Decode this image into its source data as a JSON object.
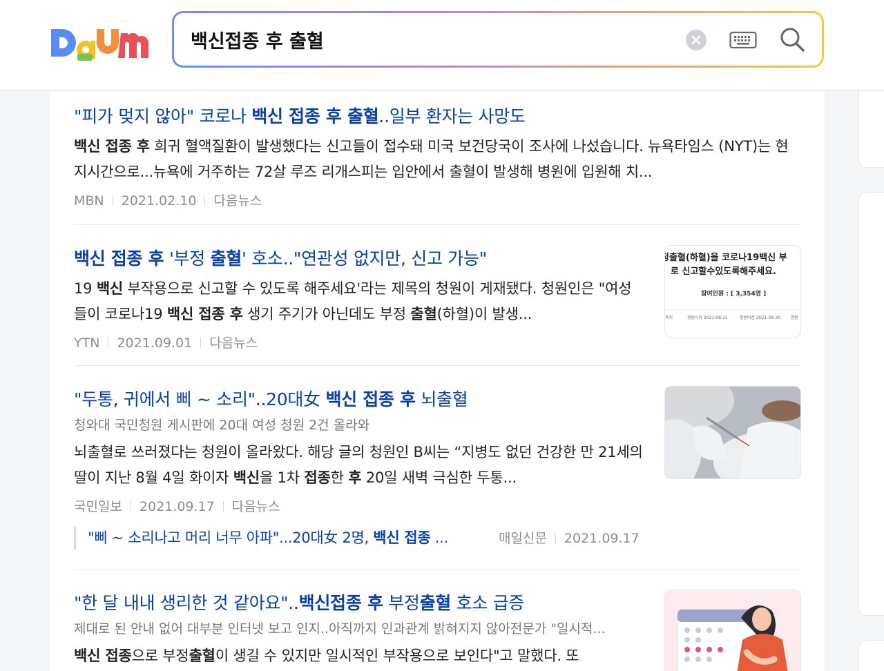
{
  "header": {
    "logo_text": "Daum",
    "search_value": "백신접종 후 출혈",
    "clear_icon": "close-icon",
    "keyboard_icon": "keyboard-icon",
    "search_icon": "search-icon"
  },
  "results": [
    {
      "title_parts": [
        {
          "t": "\"피가 멎지 않아\" 코로나 ",
          "b": false
        },
        {
          "t": "백신 접종 후 출혈",
          "b": true
        },
        {
          "t": "..일부 환자는 사망도",
          "b": false
        }
      ],
      "desc_parts": [
        {
          "t": "백신 접종 후",
          "b": true
        },
        {
          "t": " 희귀 혈액질환이 발생했다는 신고들이 접수돼 미국 보건당국이 조사에 나섰습니다. 뉴욕타임스 (NYT)는 현지시간으로...뉴욕에 거주하는 72살 루즈 리개스피는 입안에서 출혈이 발생해 병원에 입원해 치...",
          "b": false
        }
      ],
      "source": "MBN",
      "date": "2021.02.10",
      "platform": "다음뉴스"
    },
    {
      "title_parts": [
        {
          "t": "백신 접종 후",
          "b": true
        },
        {
          "t": " '부정 ",
          "b": false
        },
        {
          "t": "출혈",
          "b": true
        },
        {
          "t": "' 호소..\"연관성 없지만, 신고 가능\"",
          "b": false
        }
      ],
      "desc_parts": [
        {
          "t": "19 ",
          "b": false
        },
        {
          "t": "백신",
          "b": true
        },
        {
          "t": " 부작용으로 신고할 수 있도록 해주세요'라는 제목의 청원이 게재됐다. 청원인은 \"여성들이 코로나19 ",
          "b": false
        },
        {
          "t": "백신 접종 후",
          "b": true
        },
        {
          "t": " 생기 주기가 아닌데도 부정 ",
          "b": false
        },
        {
          "t": "출혈",
          "b": true
        },
        {
          "t": "(하혈)이 발생...",
          "b": false
        }
      ],
      "source": "YTN",
      "date": "2021.09.01",
      "platform": "다음뉴스",
      "thumb": {
        "line1": "정출혈(하혈)을 코로나19백신 부",
        "line2": "로 신고할수있도록해주세요.",
        "participants": "참여인원 : [ 3,354명 ]",
        "start": "청원시작 2021-08-31",
        "end": "청원마감 2021-09-30",
        "edge_left": "목지",
        "edge_right": "청원"
      }
    },
    {
      "title_parts": [
        {
          "t": "\"두통, 귀에서 삐 ~ 소리\"..20대女 ",
          "b": false
        },
        {
          "t": "백신 접종 후",
          "b": true
        },
        {
          "t": " 뇌출혈",
          "b": false
        }
      ],
      "subtitle": "청와대 국민청원 게시판에 20대 여성 청원 2건 올라와",
      "desc_parts": [
        {
          "t": "뇌출혈로 쓰러졌다는 청원이 올라왔다. 해당 글의 청원인 B씨는 “지병도 없던 건강한 만 21세의 딸이 지난 8월 4일 화이자 ",
          "b": false
        },
        {
          "t": "백신",
          "b": true
        },
        {
          "t": "을 1차 ",
          "b": false
        },
        {
          "t": "접종",
          "b": true
        },
        {
          "t": "한 ",
          "b": false
        },
        {
          "t": "후",
          "b": true
        },
        {
          "t": " 20일 새벽 극심한 두통...",
          "b": false
        }
      ],
      "source": "국민일보",
      "date": "2021.09.17",
      "platform": "다음뉴스",
      "related": {
        "title_parts": [
          {
            "t": "\"삐 ~  소리나고 머리 너무 아파\"...20대女 2명, ",
            "b": false
          },
          {
            "t": "백신 접종",
            "b": true
          },
          {
            "t": " ...",
            "b": false
          }
        ],
        "source": "매일신문",
        "date": "2021.09.17"
      }
    },
    {
      "title_parts": [
        {
          "t": "\"한 달 내내 생리한 것 같아요\"..",
          "b": false
        },
        {
          "t": "백신접종 후",
          "b": true
        },
        {
          "t": " 부정",
          "b": false
        },
        {
          "t": "출혈",
          "b": true
        },
        {
          "t": " 호소 급증",
          "b": false
        }
      ],
      "subtitle": "제대로 된 안내 없어 대부분 인터넷 보고 인지..아직까지 인과관계 밝혀지지 않아전문가 \"일시적...",
      "desc_parts": [
        {
          "t": "백신 접종",
          "b": true
        },
        {
          "t": "으로 부정",
          "b": false
        },
        {
          "t": "출혈",
          "b": true
        },
        {
          "t": "이 생길 수 있지만 일시적인 부작용으로 보인다\"고 말했다. 또",
          "b": false
        }
      ]
    }
  ]
}
